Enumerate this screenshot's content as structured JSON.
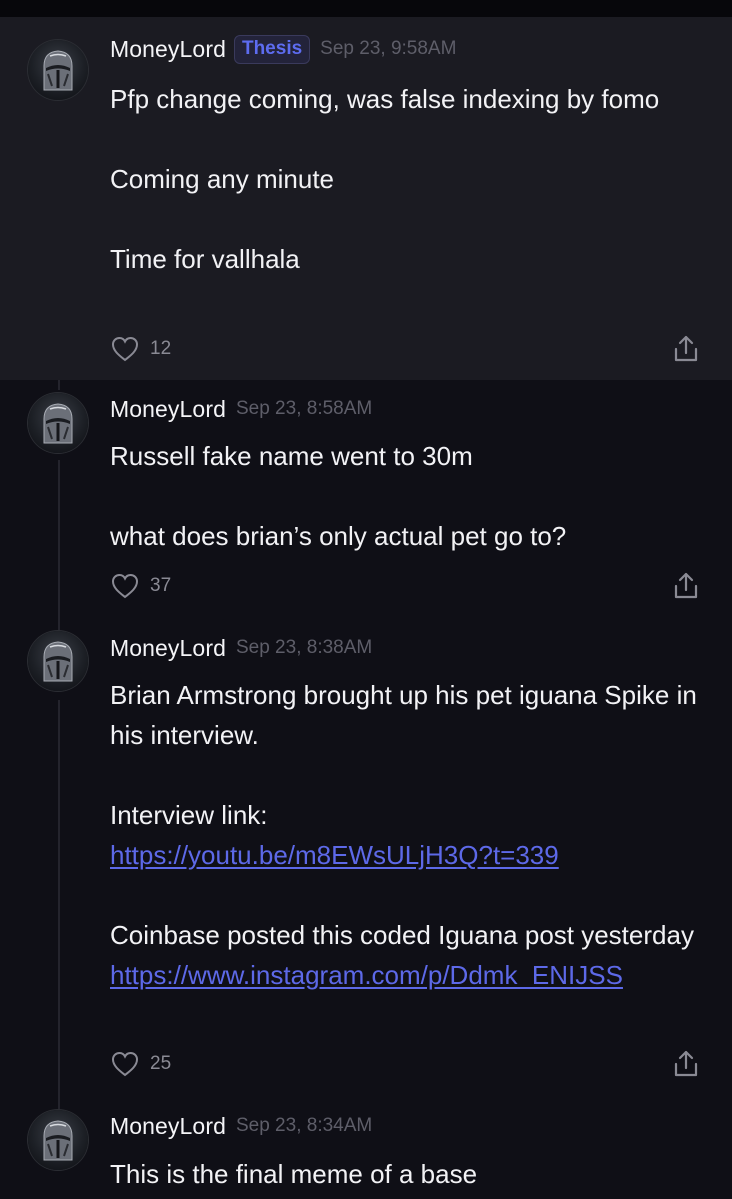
{
  "posts": [
    {
      "username": "MoneyLord",
      "badge": "Thesis",
      "timestamp": "Sep 23, 9:58AM",
      "lines": [
        "Pfp change coming, was false indexing by fomo",
        "",
        "Coming any minute",
        "",
        "Time for vallhala"
      ],
      "likes": "12",
      "highlighted": true
    },
    {
      "username": "MoneyLord",
      "timestamp": "Sep 23, 8:58AM",
      "lines": [
        "Russell fake name went to 30m",
        "",
        "what does brian’s only actual pet go to?"
      ],
      "likes": "37"
    },
    {
      "username": "MoneyLord",
      "timestamp": "Sep 23, 8:38AM",
      "lines": [
        "Brian Armstrong brought up his pet iguana Spike in his interview.",
        "",
        "Interview link:"
      ],
      "link1": "https://youtu.be/m8EWsULjH3Q?t=339",
      "lines2": [
        "Coinbase posted this coded Iguana post yesterday"
      ],
      "link2": "https://www.instagram.com/p/Ddmk_ENIJSS",
      "likes": "25"
    },
    {
      "username": "MoneyLord",
      "timestamp": "Sep 23, 8:34AM",
      "lines": [
        "This is the final meme of a base"
      ]
    }
  ],
  "icons": {
    "like": "heart-outline-icon",
    "share": "share-upload-icon",
    "avatar": "knight-helmet-avatar"
  },
  "colors": {
    "background": "#0f0f16",
    "highlight_background": "#1b1b22",
    "badge_text": "#5d6cf0",
    "link": "#5d69e8",
    "timestamp": "#5e5e69"
  }
}
